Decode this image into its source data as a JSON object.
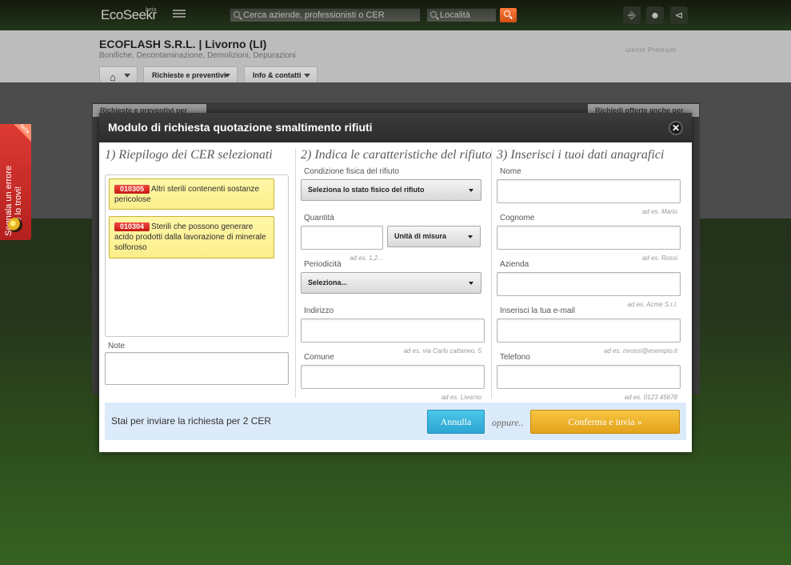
{
  "topbar": {
    "logo": "EcoSeekr",
    "logo_badge": "beta",
    "search_placeholder": "Cerca aziende, professionisti o CER",
    "location_placeholder": "Località",
    "icons": [
      "menu-icon",
      "search-icon",
      "login-icon",
      "user-add-icon",
      "share-icon"
    ]
  },
  "company": {
    "name": "ECOFLASH S.R.L. | Livorno (LI)",
    "categories": "Bonifiche, Decontaminazione, Demolizioni, Depurazioni",
    "badge": "utente Premium",
    "tabs": [
      {
        "label": "Richieste e preventivi"
      },
      {
        "label": "Info & contatti"
      }
    ],
    "behind_tabs": [
      "Richieste e preventivi per",
      "Richiedi offerte anche per"
    ]
  },
  "ribbon": {
    "line1": "Segnala un errore",
    "line2": "se lo trovi!",
    "badge": "beta"
  },
  "modal": {
    "title": "Modulo di richiesta quotazione smaltimento rifiuti",
    "close_glyph": "✕",
    "col1": {
      "title": "1) Riepilogo dei CER selezionati",
      "cer_items": [
        {
          "code": "010305",
          "text": "Altri sterili contenenti sostanze pericolose"
        },
        {
          "code": "010304",
          "text": "Sterili che possono generare acido prodotti dalla lavorazione di minerale solforoso"
        }
      ],
      "note_label": "Note"
    },
    "col2": {
      "title": "2) Indica le caratteristiche del rifiuto",
      "condizione_label": "Condizione fisica del rifiuto",
      "condizione_value": "Seleziona lo stato fisico del rifiuto",
      "quantita_label": "Quantità",
      "unita_value": "Unità di misura",
      "quantita_hint": "ad es. 1,2...",
      "periodicita_label": "Periodicità",
      "periodicita_value": "Seleziona...",
      "indirizzo_label": "Indirizzo",
      "indirizzo_hint": "ad es. via Carlo cattaneo, 5",
      "comune_label": "Comune",
      "comune_hint": "ad es. Livorno"
    },
    "col3": {
      "title": "3) Inserisci i tuoi dati anagrafici",
      "nome_label": "Nome",
      "nome_hint": "ad es. Mario",
      "cognome_label": "Cognome",
      "cognome_hint": "ad es. Rossi",
      "azienda_label": "Azienda",
      "azienda_hint": "ad es. Acme S.r.l.",
      "email_label": "Inserisci la tua e-mail",
      "email_hint": "ad es. mrossi@esempio.it",
      "telefono_label": "Telefono",
      "telefono_hint": "ad es. 0123 45678"
    },
    "footer": {
      "summary": "Stai per inviare la richiesta per 2 CER",
      "cancel_label": "Annulla",
      "or_label": "oppure..",
      "confirm_label": "Conferma e invia »"
    }
  }
}
